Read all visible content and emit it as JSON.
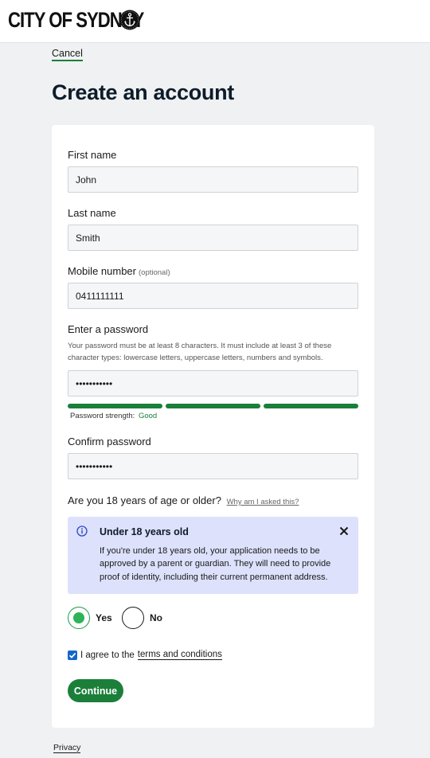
{
  "header": {
    "logo_text": "CITY OF SYDNEY",
    "logo_icon": "anchor-emblem-icon"
  },
  "nav": {
    "cancel_label": "Cancel"
  },
  "page": {
    "title": "Create an account"
  },
  "form": {
    "first_name": {
      "label": "First name",
      "value": "John"
    },
    "last_name": {
      "label": "Last name",
      "value": "Smith"
    },
    "mobile": {
      "label": "Mobile number",
      "optional": "(optional)",
      "value": "0411111111"
    },
    "password": {
      "label": "Enter a password",
      "help": "Your password must be at least 8 characters. It must include at least 3 of these character types: lowercase letters, uppercase letters, numbers and symbols.",
      "value": "•••••••••••",
      "strength_label": "Password strength:",
      "strength_value": "Good",
      "strength_level": "3/3"
    },
    "confirm_password": {
      "label": "Confirm password",
      "value": "•••••••••••"
    },
    "age": {
      "question": "Are you 18 years of age or older?",
      "why_link": "Why am I asked this?",
      "info_title": "Under 18 years old",
      "info_body": "If you're under 18 years old, your application needs to be approved by a parent or guardian. They will need to provide proof of identity, including their current permanent address.",
      "yes_label": "Yes",
      "no_label": "No",
      "selected": "Yes"
    },
    "agree": {
      "prefix": "I agree to the",
      "link": "terms and conditions",
      "checked": true
    },
    "submit_label": "Continue"
  },
  "footer": {
    "privacy_label": "Privacy"
  },
  "colors": {
    "accent": "#1b7f3a",
    "radio_fill": "#2fb35a",
    "info_bg": "#dde1fb",
    "checkbox": "#1466c6"
  }
}
